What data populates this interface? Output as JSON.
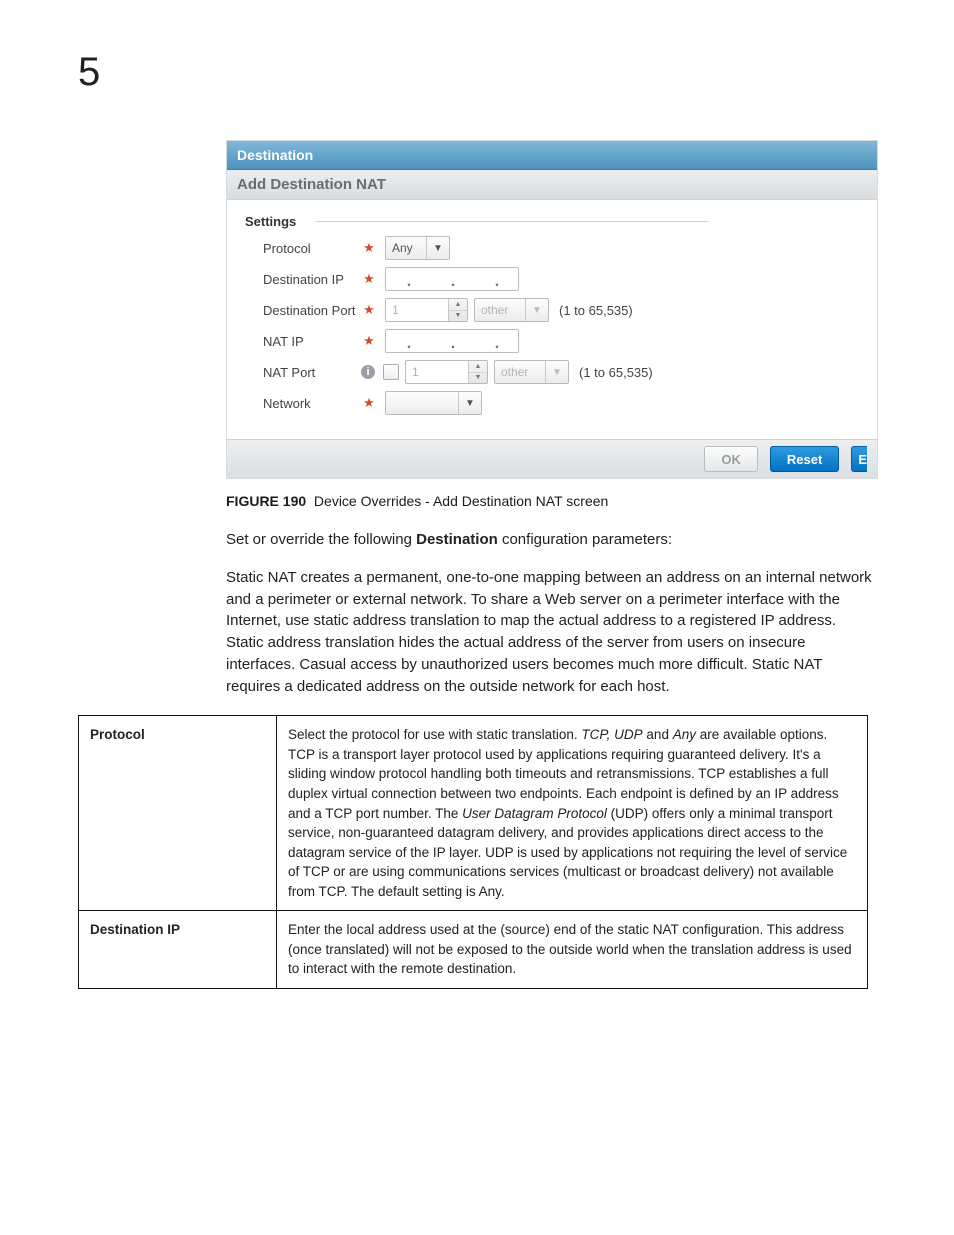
{
  "chapter": "5",
  "screenshot": {
    "titlebar": "Destination",
    "subtitle": "Add Destination NAT",
    "fieldset_label": "Settings",
    "rows": {
      "protocol": {
        "label": "Protocol",
        "value": "Any"
      },
      "dest_ip": {
        "label": "Destination IP"
      },
      "dest_port": {
        "label": "Destination Port",
        "value": "1",
        "unit": "other",
        "hint": "(1 to 65,535)"
      },
      "nat_ip": {
        "label": "NAT IP"
      },
      "nat_port": {
        "label": "NAT Port",
        "value": "1",
        "unit": "other",
        "hint": "(1 to 65,535)"
      },
      "network": {
        "label": "Network",
        "value": ""
      }
    },
    "buttons": {
      "ok": "OK",
      "reset": "Reset",
      "exit_frag": "E"
    }
  },
  "figure": {
    "label": "FIGURE 190",
    "title": "Device Overrides - Add Destination NAT screen"
  },
  "para_intro_pre": "Set or override the following ",
  "para_intro_bold": "Destination",
  "para_intro_post": " configuration parameters:",
  "para_static_nat": "Static NAT creates a permanent, one-to-one mapping between an address on an internal network and a perimeter or external network. To share a Web server on a perimeter interface with the Internet, use static address translation to map the actual address to a registered IP address. Static address translation hides the actual address of the server from users on insecure interfaces. Casual access by unauthorized users becomes much more difficult. Static NAT requires a dedicated address on the outside network for each host.",
  "table": {
    "protocol": {
      "term": "Protocol",
      "def_pre": "Select the protocol for use with static translation. ",
      "def_em1": "TCP, UDP",
      "def_mid1": " and ",
      "def_em2": "Any",
      "def_mid2": " are available options. TCP is a transport layer protocol used by applications requiring guaranteed delivery. It's a sliding window protocol handling both timeouts and retransmissions. TCP establishes a full duplex virtual connection between two endpoints. Each endpoint is defined by an IP address and a TCP port number. The ",
      "def_em3": "User Datagram Protocol",
      "def_post": " (UDP) offers only a minimal transport service, non-guaranteed datagram delivery, and provides applications direct access to the datagram service of the IP layer. UDP is used by applications not requiring the level of service of TCP or are using communications services (multicast or broadcast delivery) not available from TCP. The default setting is Any."
    },
    "dest_ip": {
      "term": "Destination IP",
      "def": "Enter the local address used at the (source) end of the static NAT configuration. This address (once translated) will not be exposed to the outside world when the translation address is used to interact with the remote destination."
    }
  }
}
